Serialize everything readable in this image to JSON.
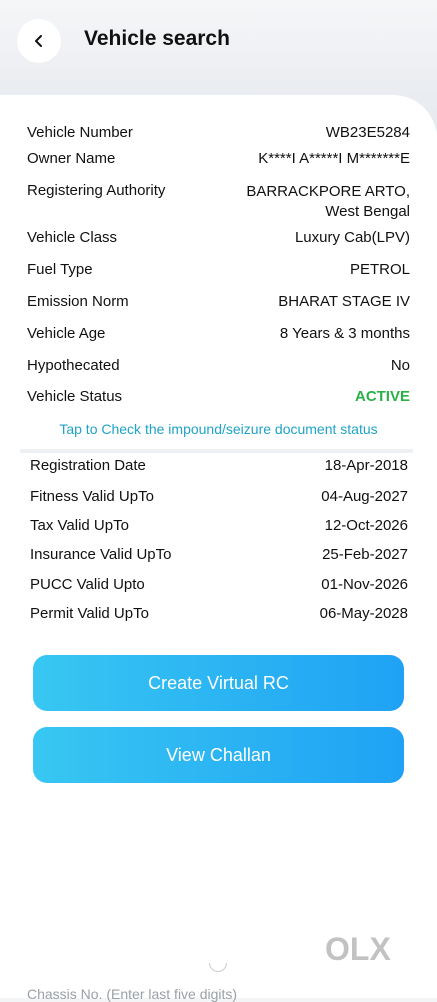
{
  "header": {
    "title": "Vehicle search"
  },
  "details": [
    {
      "label": "Vehicle Number",
      "value": "WB23E5284"
    },
    {
      "label": "Owner Name",
      "value": "K****I A*****I M*******E"
    },
    {
      "label": "Registering Authority",
      "value": "BARRACKPORE ARTO, West Bengal"
    },
    {
      "label": "Vehicle Class",
      "value": "Luxury Cab(LPV)"
    },
    {
      "label": "Fuel Type",
      "value": "PETROL"
    },
    {
      "label": "Emission Norm",
      "value": "BHARAT STAGE IV"
    },
    {
      "label": "Vehicle Age",
      "value": "8 Years  & 3 months"
    },
    {
      "label": "Hypothecated",
      "value": "No"
    },
    {
      "label": "Vehicle Status",
      "value": "ACTIVE"
    }
  ],
  "impound_link": "Tap to Check the impound/seizure document status",
  "validity": [
    {
      "label": "Registration Date",
      "value": "18-Apr-2018"
    },
    {
      "label": "Fitness Valid UpTo",
      "value": "04-Aug-2027"
    },
    {
      "label": "Tax Valid UpTo",
      "value": "12-Oct-2026"
    },
    {
      "label": "Insurance Valid UpTo",
      "value": "25-Feb-2027"
    },
    {
      "label": "PUCC Valid Upto",
      "value": "01-Nov-2026"
    },
    {
      "label": "Permit Valid UpTo",
      "value": "06-May-2028"
    }
  ],
  "buttons": {
    "virtual_rc": "Create Virtual RC",
    "challan": "View Challan"
  },
  "chassis_placeholder": "Chassis No. (Enter last five digits)",
  "watermark": "OLX",
  "colors": {
    "accent": "#1fa2f4",
    "active": "#2bb14a",
    "link": "#1fa3c8"
  }
}
